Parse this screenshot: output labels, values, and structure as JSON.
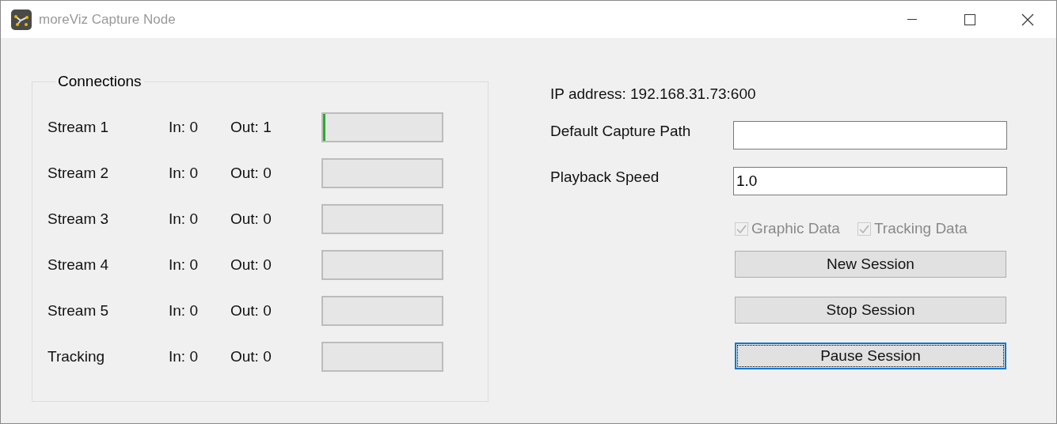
{
  "window": {
    "title": "moreViz Capture Node"
  },
  "connections": {
    "title": "Connections",
    "streams": [
      {
        "name": "Stream 1",
        "in": "In: 0",
        "out": "Out: 1",
        "level": 0.02
      },
      {
        "name": "Stream 2",
        "in": "In: 0",
        "out": "Out: 0"
      },
      {
        "name": "Stream 3",
        "in": "In: 0",
        "out": "Out: 0"
      },
      {
        "name": "Stream 4",
        "in": "In: 0",
        "out": "Out: 0"
      },
      {
        "name": "Stream 5",
        "in": "In: 0",
        "out": "Out: 0"
      },
      {
        "name": "Tracking",
        "in": "In: 0",
        "out": "Out: 0"
      }
    ]
  },
  "ip_address": "IP address: 192.168.31.73:600",
  "fields": [
    {
      "label": "Default Capture Path"
    },
    {
      "label": "Playback Speed",
      "value": "1.0"
    }
  ],
  "checkboxes": [
    {
      "label": "Graphic Data",
      "checked": true,
      "disabled": true
    },
    {
      "label": "Tracking Data",
      "checked": true,
      "disabled": true
    }
  ],
  "buttons": [
    {
      "label": "New Session",
      "focused": false
    },
    {
      "label": "Stop Session",
      "focused": false
    },
    {
      "label": "Pause Session",
      "focused": true
    }
  ]
}
